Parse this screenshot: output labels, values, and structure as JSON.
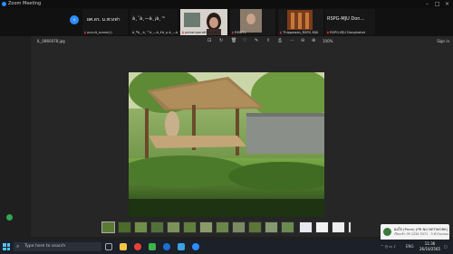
{
  "window": {
    "title": "Zoom Meeting"
  },
  "participants": [
    {
      "big": "",
      "name": "occult_scene(r)"
    },
    {
      "big": "ผศ.ดร. ม.พวงฟา",
      "name": ""
    },
    {
      "big": "à¸ˆà¸—à¸¡à¸™",
      "name": "à¸ªà¸¸à¸™à¸—à¸£à¸µ à¸—à¸°"
    },
    {
      "big": "",
      "name": "pairamparathamrithy"
    },
    {
      "big": "",
      "name": "RMUTL"
    },
    {
      "big": "",
      "name": "Thippawan_RSPG-MJU"
    },
    {
      "big": "RSPG-MJU  Don…",
      "name": "RSPG-MJU Donghahat"
    }
  ],
  "viewer": {
    "filename": "IL_0860078.jpg",
    "zoom": "100%",
    "signin": "Sign in"
  },
  "taskbar": {
    "search_placeholder": "Type here to search",
    "time": "11:36",
    "date": "26/10/2565",
    "lang": "ENG"
  },
  "toast": {
    "title": "ผมใจ (Pmm) (PR NU NETWORK)",
    "sub": "เรียกเข้า 09 1234 5371 · 3 ชั่วโมงก่อน"
  },
  "colors": {
    "accent": "#2d8cff"
  }
}
